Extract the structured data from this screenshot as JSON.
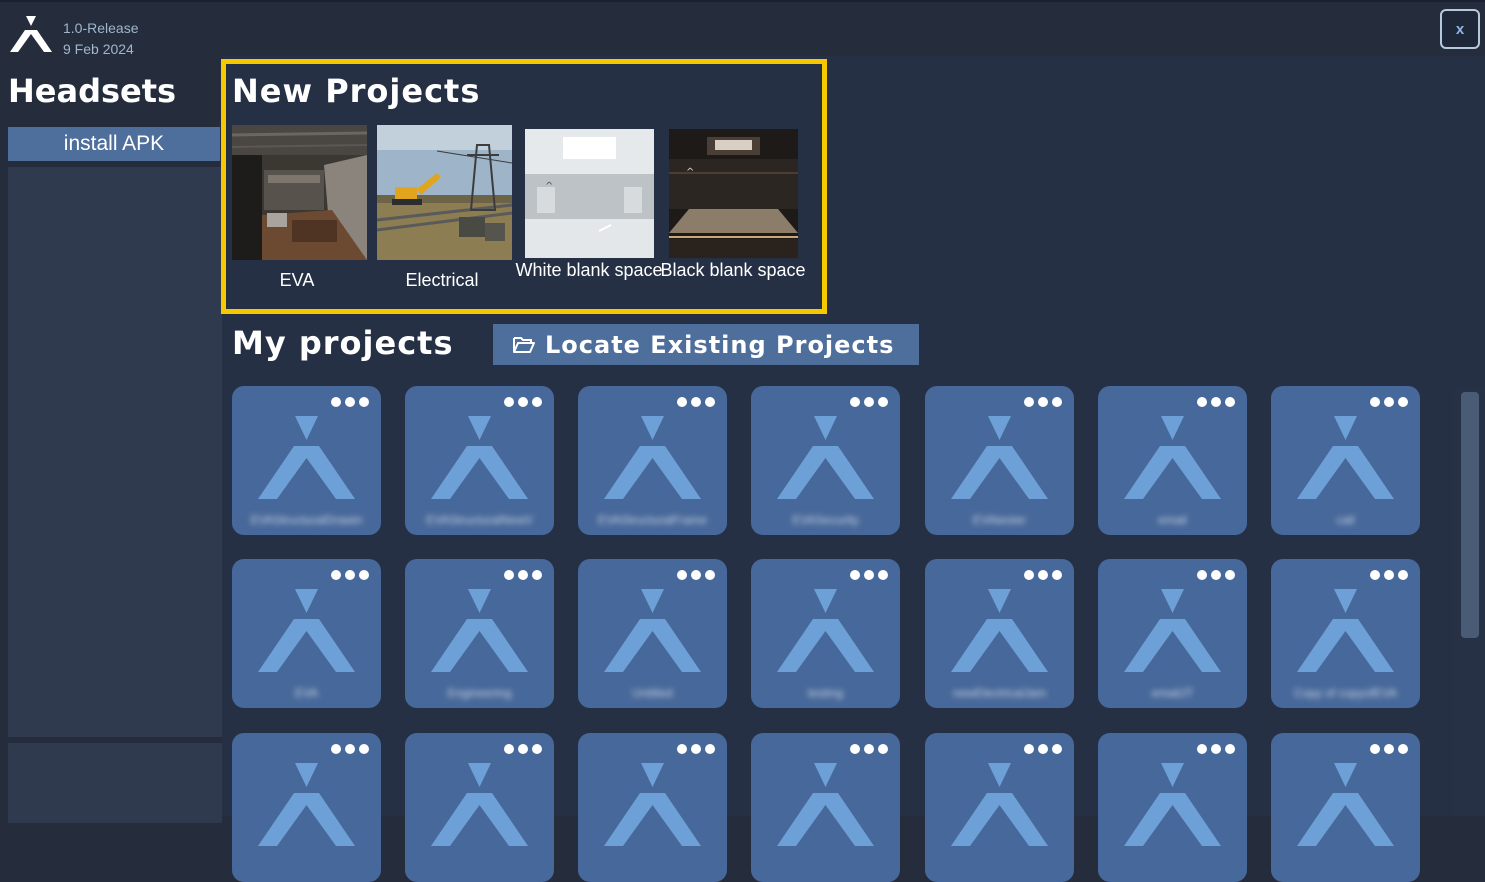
{
  "app": {
    "version": "1.0-Release",
    "date": "9 Feb 2024",
    "close_label": "x"
  },
  "sidebar": {
    "title": "Headsets",
    "install_label": "install APK"
  },
  "new_projects": {
    "title": "New Projects",
    "templates": [
      {
        "label": "EVA",
        "image": "kitchen-interior"
      },
      {
        "label": "Electrical",
        "image": "excavator-power-lines"
      },
      {
        "label": "White blank space",
        "image": "white-room"
      },
      {
        "label": "Black blank space",
        "image": "dark-room"
      }
    ]
  },
  "my_projects": {
    "title": "My projects",
    "locate_label": "Locate Existing Projects",
    "locate_icon": "folder-open-icon",
    "card_icon": "app-logo-icon",
    "menu_icon": "more-dots-icon",
    "names": [
      "EVAStructuralDrawin",
      "EVAStructuralNewV",
      "EVAStructuralFrame",
      "EVASecurity",
      "EVAtester",
      "email",
      "call",
      "EVA",
      "Engineering",
      "Untitled",
      "testing",
      "newElectricalJam",
      "emailJT",
      "Copy of copyofEVA",
      "",
      "",
      "",
      "",
      "",
      "",
      ""
    ]
  },
  "colors": {
    "background": "#252d3c",
    "accent": "#4e6e9c",
    "highlight": "#f5c800",
    "card": "#47689a"
  }
}
